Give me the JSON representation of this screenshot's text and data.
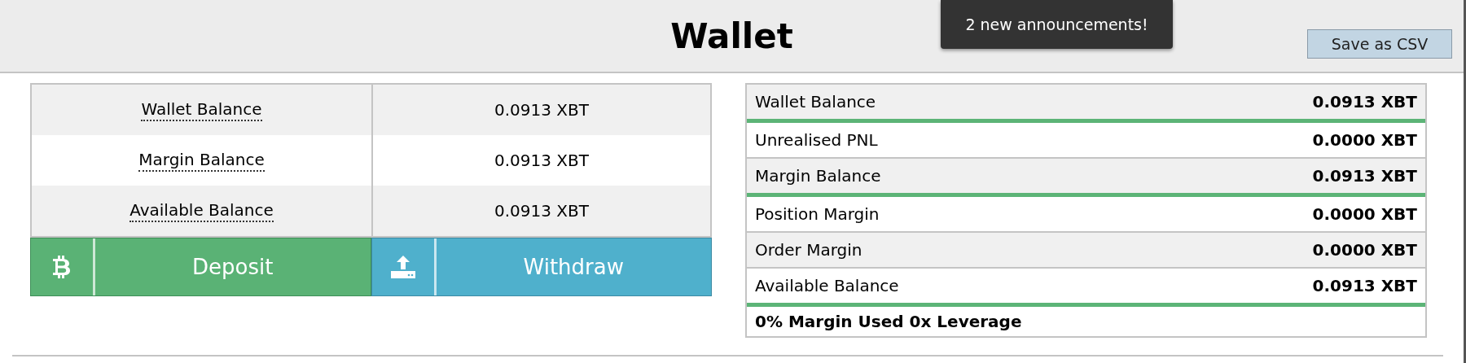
{
  "header": {
    "title": "Wallet",
    "announcement": "2 new announcements!",
    "save_button": "Save as CSV"
  },
  "balances": [
    {
      "label": "Wallet Balance",
      "value": "0.0913 XBT"
    },
    {
      "label": "Margin Balance",
      "value": "0.0913 XBT"
    },
    {
      "label": "Available Balance",
      "value": "0.0913 XBT"
    }
  ],
  "actions": [
    {
      "kind": "deposit",
      "label": "Deposit"
    },
    {
      "kind": "withdraw",
      "label": "Withdraw"
    }
  ],
  "summary": {
    "rows": [
      {
        "label": "Wallet Balance",
        "value": "0.0913 XBT",
        "accent": true
      },
      {
        "label": "Unrealised PNL",
        "value": "0.0000 XBT",
        "accent": false
      },
      {
        "label": "Margin Balance",
        "value": "0.0913 XBT",
        "accent": true
      },
      {
        "label": "Position Margin",
        "value": "0.0000 XBT",
        "accent": false
      },
      {
        "label": "Order Margin",
        "value": "0.0000 XBT",
        "accent": false
      },
      {
        "label": "Available Balance",
        "value": "0.0913 XBT",
        "accent": true
      }
    ],
    "footer": "0% Margin Used 0x Leverage"
  }
}
